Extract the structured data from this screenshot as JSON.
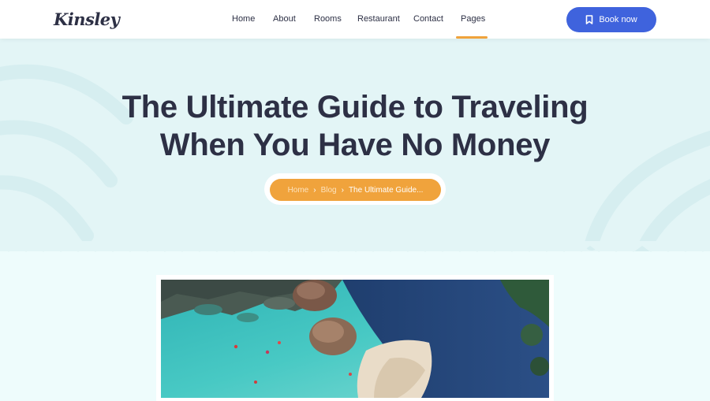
{
  "header": {
    "logo": "Kinsley",
    "nav": [
      {
        "label": "Home"
      },
      {
        "label": "About"
      },
      {
        "label": "Rooms"
      },
      {
        "label": "Restaurant"
      },
      {
        "label": "Contact"
      },
      {
        "label": "Pages"
      }
    ],
    "active_nav": "Pages",
    "book_button": {
      "label": "Book now",
      "icon": "bookmark-icon"
    }
  },
  "hero": {
    "title_line1": "The Ultimate Guide to Traveling",
    "title_line2": "When You Have No Money"
  },
  "breadcrumb": {
    "items": [
      "Home",
      "Blog",
      "The Ultimate Guide..."
    ],
    "separator_icon": "chevron-right-icon"
  },
  "featured_image": {
    "icon": "aerial-beach-photo"
  },
  "colors": {
    "accent_blue": "#3f63dd",
    "accent_orange": "#f0a33c",
    "text_dark": "#2d3045",
    "hero_bg": "#e3f5f6",
    "page_bg": "#eefcfc"
  }
}
